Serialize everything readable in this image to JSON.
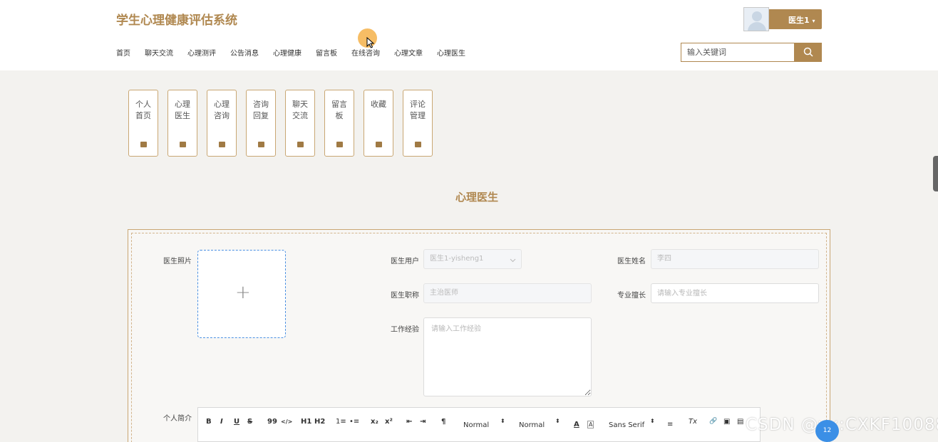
{
  "header": {
    "site_title": "学生心理健康评估系统",
    "nav": [
      "首页",
      "聊天交流",
      "心理测评",
      "公告消息",
      "心理健康",
      "留言板",
      "在线咨询",
      "心理文章",
      "心理医生"
    ],
    "user_name": "医生1",
    "user_caret": "▾",
    "search_placeholder": "输入关键词"
  },
  "side_tabs": [
    {
      "label": "个人首页"
    },
    {
      "label": "心理医生"
    },
    {
      "label": "心理咨询"
    },
    {
      "label": "咨询回复"
    },
    {
      "label": "聊天交流"
    },
    {
      "label": "留言板"
    },
    {
      "label": "收藏"
    },
    {
      "label": "评论管理"
    }
  ],
  "page": {
    "section_title": "心理医生"
  },
  "form": {
    "photo_label": "医生照片",
    "upload_plus": "+",
    "user_label": "医生用户",
    "user_value": "医生1-yisheng1",
    "name_label": "医生姓名",
    "name_value": "李四",
    "title_label": "医生职称",
    "title_value": "主治医师",
    "specialty_label": "专业擅长",
    "specialty_placeholder": "请输入专业擅长",
    "experience_label": "工作经验",
    "experience_placeholder": "请输入工作经验",
    "intro_label": "个人简介"
  },
  "editor_toolbar": {
    "bold": "B",
    "italic": "I",
    "underline": "U",
    "strike": "S",
    "quote": "99",
    "code": "</>",
    "h1": "H1",
    "h2": "H2",
    "ordered_list": "1≡",
    "bullet_list": "•≡",
    "subscript": "x₂",
    "superscript": "x²",
    "outdent": "⇤",
    "indent": "⇥",
    "direction": "¶",
    "size_select": "Normal",
    "header_select": "Normal",
    "color": "A",
    "background": "A",
    "font_select": "Sans Serif",
    "align": "≡",
    "clean": "Tx",
    "link": "🔗",
    "image": "▣",
    "video": "▤"
  },
  "watermark": "CSDN @vx:CXKF10088",
  "badge": "12",
  "colors": {
    "accent": "#b08850",
    "background": "#f3f2ef",
    "upload_border": "#4a90e2"
  }
}
